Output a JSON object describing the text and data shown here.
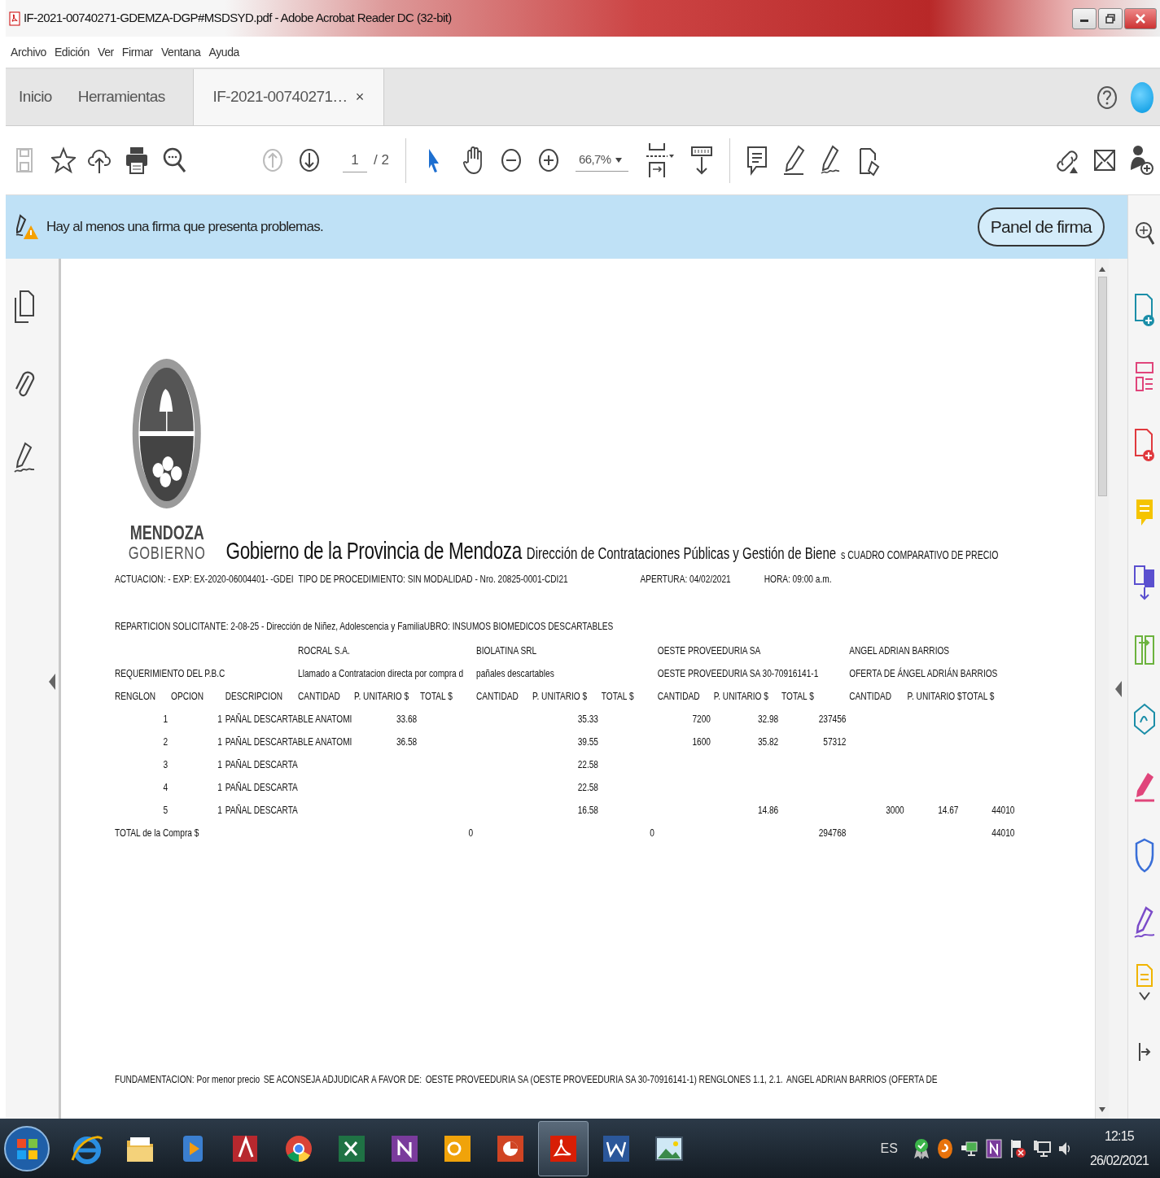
{
  "window": {
    "title": "IF-2021-00740271-GDEMZA-DGP#MSDSYD.pdf - Adobe Acrobat Reader DC (32-bit)"
  },
  "menu": [
    "Archivo",
    "Edición",
    "Ver",
    "Firmar",
    "Ventana",
    "Ayuda"
  ],
  "tabs": [
    {
      "label": "Inicio",
      "selected": false
    },
    {
      "label": "Herramientas",
      "selected": false
    },
    {
      "label": "IF-2021-00740271…",
      "selected": true,
      "close": "×"
    }
  ],
  "toolbar": {
    "page_current": "1",
    "page_total": "/ 2",
    "zoom": "66,7%"
  },
  "notification": {
    "message": "Hay al menos una firma que presenta problemas.",
    "button": "Panel de firma"
  },
  "document": {
    "logo": {
      "line1": "MENDOZA",
      "line2": "GOBIERNO"
    },
    "heading": {
      "title": "Gobierno de la Provincia de Mendoza",
      "subtitle": "Dirección de Contrataciones Públicas y Gestión de Biene",
      "report": "s CUADRO COMPARATIVO DE PRECIO"
    },
    "actuacion": "ACTUACION:  - EXP: EX-2020-06004401- -GDEI",
    "procedimiento": "TIPO DE PROCEDIMIENTO: SIN MODALIDAD - Nro. 20825-0001-CDI21",
    "apertura": "APERTURA: 04/02/2021",
    "hora": "HORA: 09:00 a.m.",
    "reparticion": "REPARTICION SOLICITANTE: 2-08-25 - Dirección de Niñez, Adolescencia y Familia",
    "rubro": "UBRO: INSUMOS BIOMEDICOS DESCARTABLES",
    "requirement_label": "REQUERIMIENTO DEL P.B.C",
    "suppliers": [
      {
        "name": "ROCRAL S.A.",
        "detail": "Llamado a Contratacion directa por compra d"
      },
      {
        "name": "BIOLATINA SRL",
        "detail": "pañales descartables"
      },
      {
        "name": "OESTE PROVEEDURIA SA",
        "detail": "OESTE PROVEEDURIA SA 30-70916141-1"
      },
      {
        "name": "ANGEL ADRIAN BARRIOS",
        "detail": "OFERTA DE ÁNGEL ADRIÁN BARRIOS"
      }
    ],
    "columns": [
      "RENGLON",
      "OPCION",
      "DESCRIPCION",
      "CANTIDAD",
      "P. UNITARIO $",
      "TOTAL $",
      "CANTIDAD",
      "P. UNITARIO $",
      "TOTAL $",
      "CANTIDAD",
      "P. UNITARIO $",
      "TOTAL $",
      "CANTIDAD",
      "P. UNITARIO $TOTAL $"
    ],
    "rows": [
      {
        "renglon": "1",
        "opcion": "1",
        "descripcion": "PAÑAL DESCARTABLE ANATOMI",
        "rocral_unitario": "33.68",
        "biolatina_unitario": "35.33",
        "oeste_cantidad": "7200",
        "oeste_unitario": "32.98",
        "oeste_total": "237456"
      },
      {
        "renglon": "2",
        "opcion": "1",
        "descripcion": "PAÑAL DESCARTABLE ANATOMI",
        "rocral_unitario": "36.58",
        "biolatina_unitario": "39.55",
        "oeste_cantidad": "1600",
        "oeste_unitario": "35.82",
        "oeste_total": "57312"
      },
      {
        "renglon": "3",
        "opcion": "1",
        "descripcion": "PAÑAL DESCARTA",
        "biolatina_unitario": "22.58"
      },
      {
        "renglon": "4",
        "opcion": "1",
        "descripcion": "PAÑAL DESCARTA",
        "biolatina_unitario": "22.58"
      },
      {
        "renglon": "5",
        "opcion": "1",
        "descripcion": "PAÑAL DESCARTA",
        "biolatina_unitario": "16.58",
        "oeste_unitario": "14.86",
        "angel_cantidad": "3000",
        "angel_unitario": "14.67",
        "angel_total": "44010"
      }
    ],
    "total_row": {
      "label": "TOTAL de la Compra $",
      "rocral_total": "0",
      "biolatina_total": "0",
      "oeste_total": "294768",
      "angel_total": "44010"
    },
    "footer": {
      "label": "FUNDAMENTACION: Por menor precio",
      "advice": "SE ACONSEJA ADJUDICAR A FAVOR DE:",
      "award_1": "OESTE PROVEEDURIA SA (OESTE PROVEEDURIA SA 30-70916141-1) RENGLONES 1.1, 2.1.",
      "award_2": "ANGEL ADRIAN BARRIOS (OFERTA DE"
    }
  },
  "taskbar": {
    "apps": [
      {
        "kind": "ie",
        "selected": false
      },
      {
        "kind": "folder",
        "selected": false
      },
      {
        "kind": "media",
        "selected": false
      },
      {
        "kind": "access",
        "selected": false
      },
      {
        "kind": "chrome",
        "selected": false
      },
      {
        "kind": "excel",
        "selected": false
      },
      {
        "kind": "onenote",
        "selected": false
      },
      {
        "kind": "outlook",
        "selected": false
      },
      {
        "kind": "powerpoint",
        "selected": false
      },
      {
        "kind": "acrobat",
        "selected": true
      },
      {
        "kind": "word",
        "selected": false
      },
      {
        "kind": "photo",
        "selected": false
      }
    ],
    "language": "ES",
    "time": "12:15",
    "date": "26/02/2021"
  }
}
